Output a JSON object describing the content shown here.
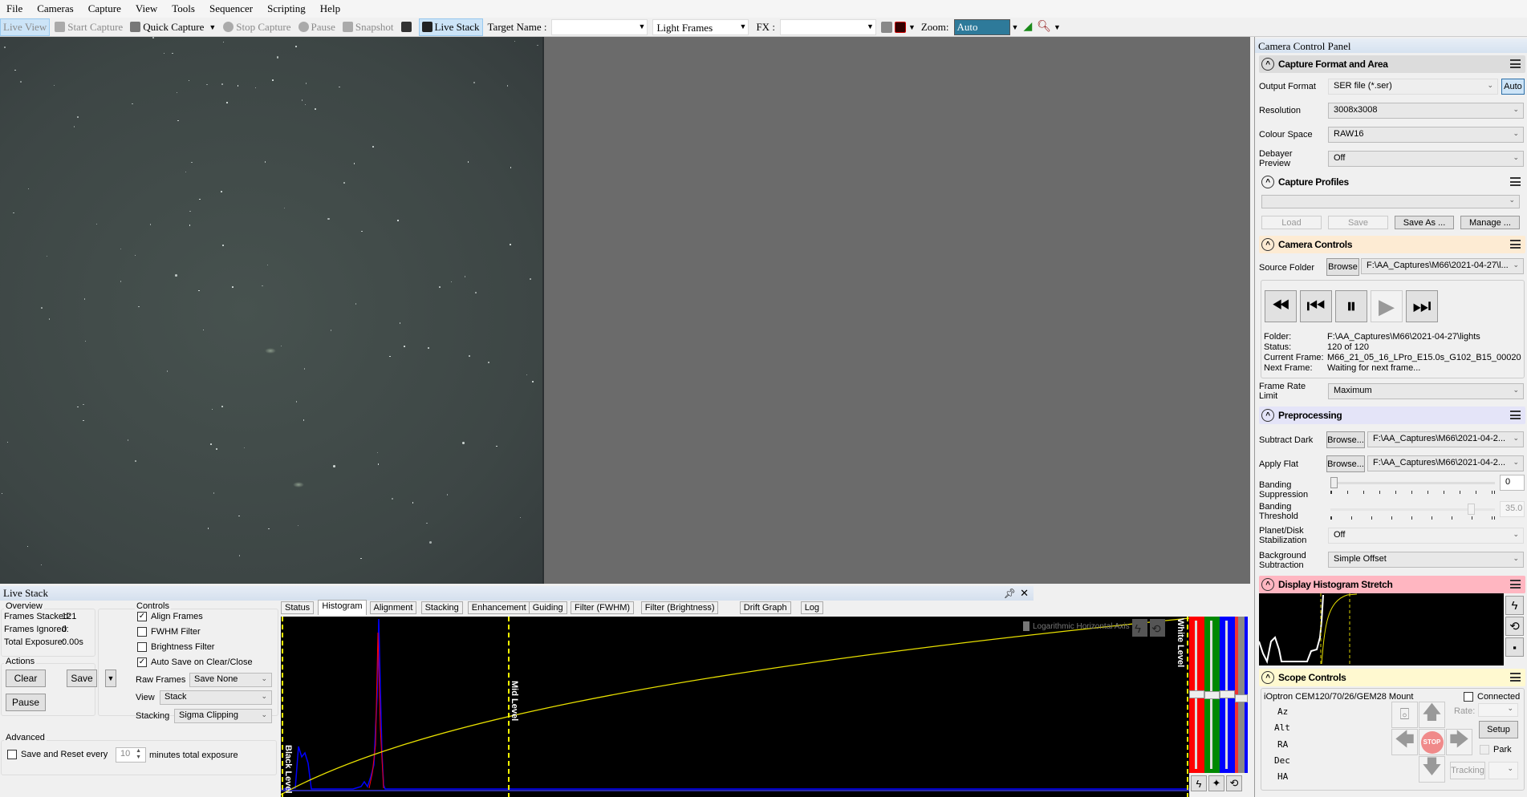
{
  "menu": [
    "File",
    "Cameras",
    "Capture",
    "View",
    "Tools",
    "Sequencer",
    "Scripting",
    "Help"
  ],
  "toolbar": {
    "live_view": "Live View",
    "start_capture": "Start Capture",
    "quick_capture": "Quick Capture",
    "stop_capture": "Stop Capture",
    "pause": "Pause",
    "snapshot": "Snapshot",
    "live_stack": "Live Stack",
    "target_name_label": "Target Name :",
    "target_name_value": "",
    "frame_type": "Light Frames",
    "fx_label": "FX :",
    "fx_value": "",
    "zoom_label": "Zoom:",
    "zoom_value": "Auto"
  },
  "panel": {
    "title": "Camera Control Panel",
    "capture_format": {
      "title": "Capture Format and Area",
      "output_format_label": "Output Format",
      "output_format": "SER file (*.ser)",
      "auto": "Auto",
      "resolution_label": "Resolution",
      "resolution": "3008x3008",
      "colour_space_label": "Colour Space",
      "colour_space": "RAW16",
      "debayer_label": "Debayer Preview",
      "debayer": "Off"
    },
    "capture_profiles": {
      "title": "Capture Profiles",
      "profile": "",
      "load": "Load",
      "save": "Save",
      "save_as": "Save As ...",
      "manage": "Manage ..."
    },
    "camera_controls": {
      "title": "Camera Controls",
      "source_folder_label": "Source Folder",
      "browse": "Browse",
      "source_folder": "F:\\AA_Captures\\M66\\2021-04-27\\l...",
      "folder_label": "Folder:",
      "folder": "F:\\AA_Captures\\M66\\2021-04-27\\lights",
      "status_label": "Status:",
      "status": "120 of 120",
      "current_frame_label": "Current Frame:",
      "current_frame": "M66_21_05_16_LPro_E15.0s_G102_B15_00020",
      "next_frame_label": "Next Frame:",
      "next_frame": "Waiting for next frame...",
      "frame_rate_label": "Frame Rate Limit",
      "frame_rate": "Maximum"
    },
    "preprocessing": {
      "title": "Preprocessing",
      "subtract_dark_label": "Subtract Dark",
      "browse": "Browse...",
      "subtract_dark": "F:\\AA_Captures\\M66\\2021-04-2...",
      "apply_flat_label": "Apply Flat",
      "apply_flat": "F:\\AA_Captures\\M66\\2021-04-2...",
      "banding_suppression_label": "Banding Suppression",
      "banding_suppression": "0",
      "banding_threshold_label": "Banding Threshold",
      "banding_threshold": "35.0",
      "planet_label": "Planet/Disk Stabilization",
      "planet": "Off",
      "background_label": "Background Subtraction",
      "background": "Simple Offset"
    },
    "histogram_stretch": {
      "title": "Display Histogram Stretch"
    },
    "scope": {
      "title": "Scope Controls",
      "mount": "iOptron CEM120/70/26/GEM28 Mount",
      "connected": "Connected",
      "axes": [
        "Az",
        "Alt",
        "RA",
        "Dec",
        "HA"
      ],
      "rate_label": "Rate:",
      "setup": "Setup",
      "park": "Park",
      "tracking": "Tracking",
      "stop": "STOP"
    }
  },
  "live_stack": {
    "title": "Live Stack",
    "overview": {
      "title": "Overview",
      "frames_stacked_label": "Frames Stacked:",
      "frames_stacked": "121",
      "frames_ignored_label": "Frames Ignored:",
      "frames_ignored": "0",
      "total_exposure_label": "Total Exposure:",
      "total_exposure": "0.00s"
    },
    "actions": {
      "title": "Actions",
      "clear": "Clear",
      "save": "Save",
      "pause": "Pause"
    },
    "controls": {
      "title": "Controls",
      "align_frames": "Align Frames",
      "fwhm_filter": "FWHM Filter",
      "brightness_filter": "Brightness Filter",
      "auto_save": "Auto Save on Clear/Close",
      "raw_frames_label": "Raw Frames",
      "raw_frames": "Save None",
      "view_label": "View",
      "view": "Stack",
      "stacking_label": "Stacking",
      "stacking": "Sigma Clipping"
    },
    "advanced": {
      "title": "Advanced",
      "save_reset_label": "Save and Reset every",
      "save_reset_value": "10",
      "save_reset_suffix": "minutes total exposure"
    },
    "tabs": [
      "Status",
      "Histogram",
      "Alignment",
      "Stacking",
      "Enhancement",
      "Guiding",
      "Filter (FWHM)",
      "Filter (Brightness)",
      "Drift Graph",
      "Log"
    ],
    "active_tab": "Histogram",
    "histogram": {
      "black_level": "Black Level",
      "mid_level": "Mid Level",
      "white_level": "White Level",
      "log_axis": "Logarithmic Horizontal Axis"
    }
  },
  "colors": {
    "curve": "#e8e000",
    "red": "#ff0000",
    "green": "#008000",
    "blue": "#0000ff",
    "stretch_header": "#ffb6c1",
    "scope_header": "#fff9d0",
    "camera_header": "#fdebd3",
    "preproc_header": "#e4e4f8"
  }
}
